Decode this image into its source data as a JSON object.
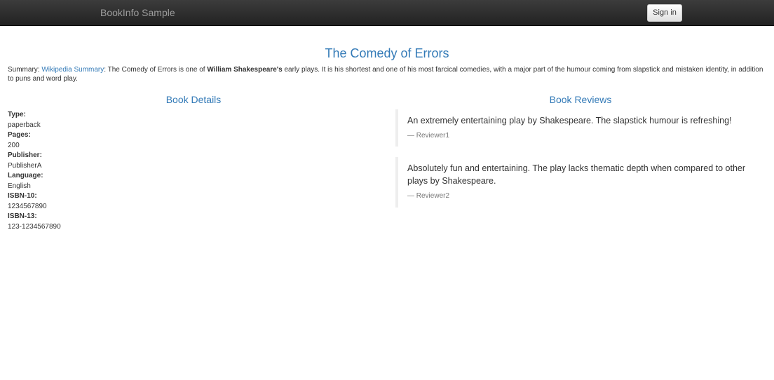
{
  "navbar": {
    "brand": "BookInfo Sample",
    "signin_label": "Sign in"
  },
  "book": {
    "title": "The Comedy of Errors",
    "summary_prefix": "Summary: ",
    "summary_link": "Wikipedia Summary",
    "summary_mid": ": The Comedy of Errors is one of ",
    "summary_author": "William Shakespeare's",
    "summary_rest": " early plays. It is his shortest and one of his most farcical comedies, with a major part of the humour coming from slapstick and mistaken identity, in addition to puns and word play."
  },
  "details": {
    "heading": "Book Details",
    "type_label": "Type:",
    "type_value": "paperback",
    "pages_label": "Pages:",
    "pages_value": "200",
    "publisher_label": "Publisher:",
    "publisher_value": "PublisherA",
    "language_label": "Language:",
    "language_value": "English",
    "isbn10_label": "ISBN-10:",
    "isbn10_value": "1234567890",
    "isbn13_label": "ISBN-13:",
    "isbn13_value": "123-1234567890"
  },
  "reviews": {
    "heading": "Book Reviews",
    "items": [
      {
        "text": "An extremely entertaining play by Shakespeare. The slapstick humour is refreshing!",
        "author": "— Reviewer1"
      },
      {
        "text": "Absolutely fun and entertaining. The play lacks thematic depth when compared to other plays by Shakespeare.",
        "author": "— Reviewer2"
      }
    ]
  }
}
